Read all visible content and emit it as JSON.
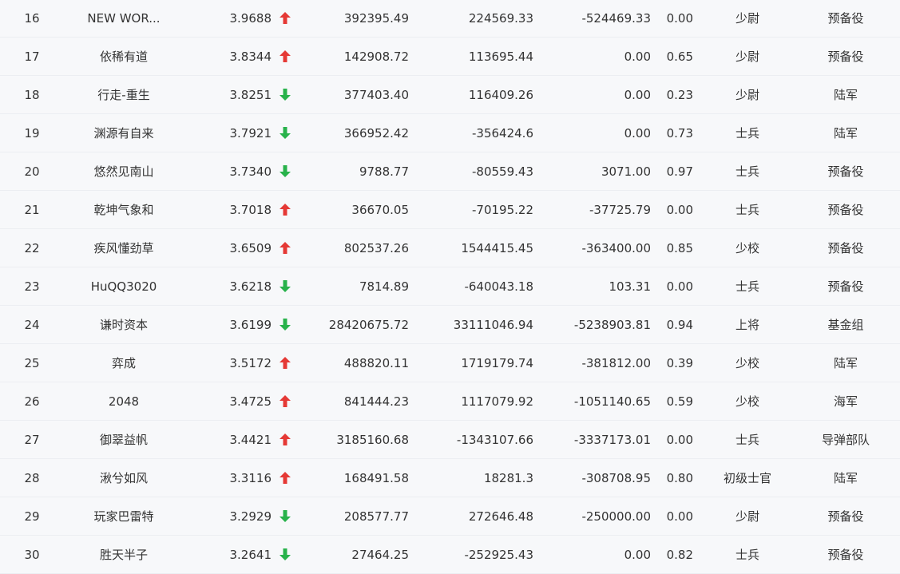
{
  "colors": {
    "up": "#e53935",
    "down": "#28b24b"
  },
  "rows": [
    {
      "rank": "16",
      "name": "NEW WOR...",
      "score": "3.9688",
      "trend": "up",
      "v1": "392395.49",
      "v2": "224569.33",
      "v3": "-524469.33",
      "ratio": "0.00",
      "title": "少尉",
      "group": "预备役"
    },
    {
      "rank": "17",
      "name": "依稀有道",
      "score": "3.8344",
      "trend": "up",
      "v1": "142908.72",
      "v2": "113695.44",
      "v3": "0.00",
      "ratio": "0.65",
      "title": "少尉",
      "group": "预备役"
    },
    {
      "rank": "18",
      "name": "行走-重生",
      "score": "3.8251",
      "trend": "down",
      "v1": "377403.40",
      "v2": "116409.26",
      "v3": "0.00",
      "ratio": "0.23",
      "title": "少尉",
      "group": "陆军"
    },
    {
      "rank": "19",
      "name": "渊源有自来",
      "score": "3.7921",
      "trend": "down",
      "v1": "366952.42",
      "v2": "-356424.6",
      "v3": "0.00",
      "ratio": "0.73",
      "title": "士兵",
      "group": "陆军"
    },
    {
      "rank": "20",
      "name": "悠然见南山",
      "score": "3.7340",
      "trend": "down",
      "v1": "9788.77",
      "v2": "-80559.43",
      "v3": "3071.00",
      "ratio": "0.97",
      "title": "士兵",
      "group": "预备役"
    },
    {
      "rank": "21",
      "name": "乾坤气象和",
      "score": "3.7018",
      "trend": "up",
      "v1": "36670.05",
      "v2": "-70195.22",
      "v3": "-37725.79",
      "ratio": "0.00",
      "title": "士兵",
      "group": "预备役"
    },
    {
      "rank": "22",
      "name": "疾风懂劲草",
      "score": "3.6509",
      "trend": "up",
      "v1": "802537.26",
      "v2": "1544415.45",
      "v3": "-363400.00",
      "ratio": "0.85",
      "title": "少校",
      "group": "预备役"
    },
    {
      "rank": "23",
      "name": "HuQQ3020",
      "score": "3.6218",
      "trend": "down",
      "v1": "7814.89",
      "v2": "-640043.18",
      "v3": "103.31",
      "ratio": "0.00",
      "title": "士兵",
      "group": "预备役"
    },
    {
      "rank": "24",
      "name": "谦时资本",
      "score": "3.6199",
      "trend": "down",
      "v1": "28420675.72",
      "v2": "33111046.94",
      "v3": "-5238903.81",
      "ratio": "0.94",
      "title": "上将",
      "group": "基金组"
    },
    {
      "rank": "25",
      "name": "弈成",
      "score": "3.5172",
      "trend": "up",
      "v1": "488820.11",
      "v2": "1719179.74",
      "v3": "-381812.00",
      "ratio": "0.39",
      "title": "少校",
      "group": "陆军"
    },
    {
      "rank": "26",
      "name": "2048",
      "score": "3.4725",
      "trend": "up",
      "v1": "841444.23",
      "v2": "1117079.92",
      "v3": "-1051140.65",
      "ratio": "0.59",
      "title": "少校",
      "group": "海军"
    },
    {
      "rank": "27",
      "name": "御翠益帆",
      "score": "3.4421",
      "trend": "up",
      "v1": "3185160.68",
      "v2": "-1343107.66",
      "v3": "-3337173.01",
      "ratio": "0.00",
      "title": "士兵",
      "group": "导弹部队"
    },
    {
      "rank": "28",
      "name": "湫兮如风",
      "score": "3.3116",
      "trend": "up",
      "v1": "168491.58",
      "v2": "18281.3",
      "v3": "-308708.95",
      "ratio": "0.80",
      "title": "初级士官",
      "group": "陆军"
    },
    {
      "rank": "29",
      "name": "玩家巴雷特",
      "score": "3.2929",
      "trend": "down",
      "v1": "208577.77",
      "v2": "272646.48",
      "v3": "-250000.00",
      "ratio": "0.00",
      "title": "少尉",
      "group": "预备役"
    },
    {
      "rank": "30",
      "name": "胜天半子",
      "score": "3.2641",
      "trend": "down",
      "v1": "27464.25",
      "v2": "-252925.43",
      "v3": "0.00",
      "ratio": "0.82",
      "title": "士兵",
      "group": "预备役"
    }
  ]
}
